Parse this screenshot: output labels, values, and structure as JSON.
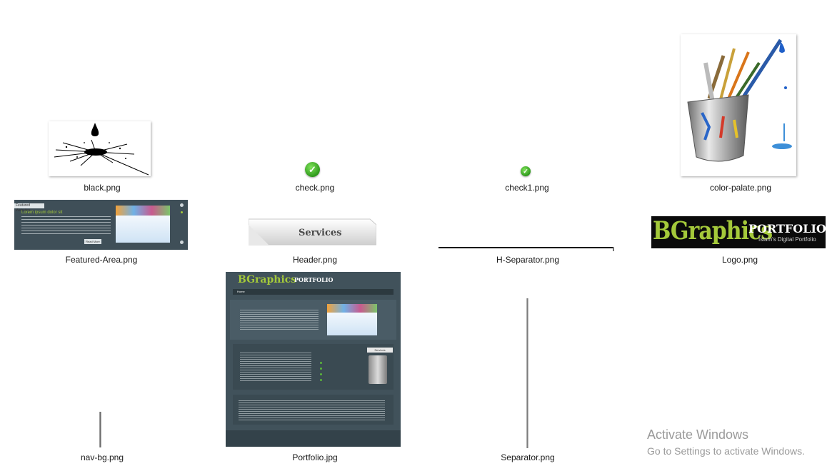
{
  "files": {
    "black": "black.png",
    "check": "check.png",
    "check1": "check1.png",
    "color_palate": "color-palate.png",
    "featured_area": "Featured-Area.png",
    "header": "Header.png",
    "h_separator": "H-Separator.png",
    "logo": "Logo.png",
    "nav_bg": "nav-bg.png",
    "portfolio": "Portfolio.jpg",
    "separator": "Separator.png"
  },
  "thumbs": {
    "header_label": "Services",
    "logo_main": "BGraphics",
    "logo_sub": "PORTFOLIO",
    "logo_tag": "Islam's Digital Portfolio",
    "featured_title": "Featured Websites",
    "featured_heading": "Lorem ipsum dolor sit",
    "featured_button": "Read More",
    "portfolio_logo_main": "BGraphics",
    "portfolio_logo_sub": "PORTFOLIO",
    "portfolio_nav_home": "Home",
    "portfolio_services_tag": "Services"
  },
  "watermark": {
    "line1": "Activate Windows",
    "line2": "Go to Settings to activate Windows."
  },
  "colors": {
    "check_green": "#2f9a1c",
    "logo_green": "#a4c93a",
    "panel_dark": "#41525b"
  }
}
